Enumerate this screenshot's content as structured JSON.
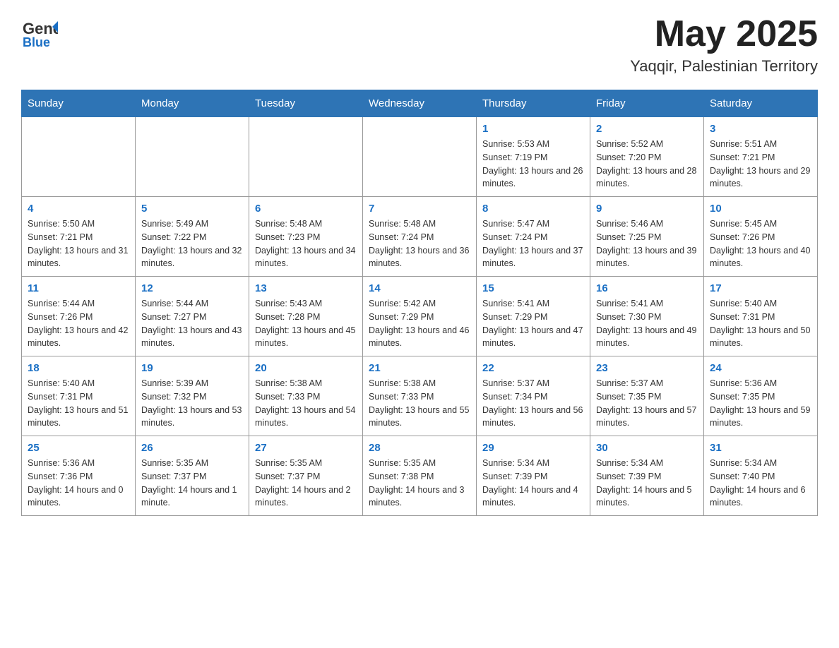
{
  "header": {
    "logo_general": "General",
    "logo_blue": "Blue",
    "month_title": "May 2025",
    "location": "Yaqqir, Palestinian Territory"
  },
  "days_of_week": [
    "Sunday",
    "Monday",
    "Tuesday",
    "Wednesday",
    "Thursday",
    "Friday",
    "Saturday"
  ],
  "weeks": [
    {
      "days": [
        {
          "num": "",
          "info": ""
        },
        {
          "num": "",
          "info": ""
        },
        {
          "num": "",
          "info": ""
        },
        {
          "num": "",
          "info": ""
        },
        {
          "num": "1",
          "info": "Sunrise: 5:53 AM\nSunset: 7:19 PM\nDaylight: 13 hours and 26 minutes."
        },
        {
          "num": "2",
          "info": "Sunrise: 5:52 AM\nSunset: 7:20 PM\nDaylight: 13 hours and 28 minutes."
        },
        {
          "num": "3",
          "info": "Sunrise: 5:51 AM\nSunset: 7:21 PM\nDaylight: 13 hours and 29 minutes."
        }
      ]
    },
    {
      "days": [
        {
          "num": "4",
          "info": "Sunrise: 5:50 AM\nSunset: 7:21 PM\nDaylight: 13 hours and 31 minutes."
        },
        {
          "num": "5",
          "info": "Sunrise: 5:49 AM\nSunset: 7:22 PM\nDaylight: 13 hours and 32 minutes."
        },
        {
          "num": "6",
          "info": "Sunrise: 5:48 AM\nSunset: 7:23 PM\nDaylight: 13 hours and 34 minutes."
        },
        {
          "num": "7",
          "info": "Sunrise: 5:48 AM\nSunset: 7:24 PM\nDaylight: 13 hours and 36 minutes."
        },
        {
          "num": "8",
          "info": "Sunrise: 5:47 AM\nSunset: 7:24 PM\nDaylight: 13 hours and 37 minutes."
        },
        {
          "num": "9",
          "info": "Sunrise: 5:46 AM\nSunset: 7:25 PM\nDaylight: 13 hours and 39 minutes."
        },
        {
          "num": "10",
          "info": "Sunrise: 5:45 AM\nSunset: 7:26 PM\nDaylight: 13 hours and 40 minutes."
        }
      ]
    },
    {
      "days": [
        {
          "num": "11",
          "info": "Sunrise: 5:44 AM\nSunset: 7:26 PM\nDaylight: 13 hours and 42 minutes."
        },
        {
          "num": "12",
          "info": "Sunrise: 5:44 AM\nSunset: 7:27 PM\nDaylight: 13 hours and 43 minutes."
        },
        {
          "num": "13",
          "info": "Sunrise: 5:43 AM\nSunset: 7:28 PM\nDaylight: 13 hours and 45 minutes."
        },
        {
          "num": "14",
          "info": "Sunrise: 5:42 AM\nSunset: 7:29 PM\nDaylight: 13 hours and 46 minutes."
        },
        {
          "num": "15",
          "info": "Sunrise: 5:41 AM\nSunset: 7:29 PM\nDaylight: 13 hours and 47 minutes."
        },
        {
          "num": "16",
          "info": "Sunrise: 5:41 AM\nSunset: 7:30 PM\nDaylight: 13 hours and 49 minutes."
        },
        {
          "num": "17",
          "info": "Sunrise: 5:40 AM\nSunset: 7:31 PM\nDaylight: 13 hours and 50 minutes."
        }
      ]
    },
    {
      "days": [
        {
          "num": "18",
          "info": "Sunrise: 5:40 AM\nSunset: 7:31 PM\nDaylight: 13 hours and 51 minutes."
        },
        {
          "num": "19",
          "info": "Sunrise: 5:39 AM\nSunset: 7:32 PM\nDaylight: 13 hours and 53 minutes."
        },
        {
          "num": "20",
          "info": "Sunrise: 5:38 AM\nSunset: 7:33 PM\nDaylight: 13 hours and 54 minutes."
        },
        {
          "num": "21",
          "info": "Sunrise: 5:38 AM\nSunset: 7:33 PM\nDaylight: 13 hours and 55 minutes."
        },
        {
          "num": "22",
          "info": "Sunrise: 5:37 AM\nSunset: 7:34 PM\nDaylight: 13 hours and 56 minutes."
        },
        {
          "num": "23",
          "info": "Sunrise: 5:37 AM\nSunset: 7:35 PM\nDaylight: 13 hours and 57 minutes."
        },
        {
          "num": "24",
          "info": "Sunrise: 5:36 AM\nSunset: 7:35 PM\nDaylight: 13 hours and 59 minutes."
        }
      ]
    },
    {
      "days": [
        {
          "num": "25",
          "info": "Sunrise: 5:36 AM\nSunset: 7:36 PM\nDaylight: 14 hours and 0 minutes."
        },
        {
          "num": "26",
          "info": "Sunrise: 5:35 AM\nSunset: 7:37 PM\nDaylight: 14 hours and 1 minute."
        },
        {
          "num": "27",
          "info": "Sunrise: 5:35 AM\nSunset: 7:37 PM\nDaylight: 14 hours and 2 minutes."
        },
        {
          "num": "28",
          "info": "Sunrise: 5:35 AM\nSunset: 7:38 PM\nDaylight: 14 hours and 3 minutes."
        },
        {
          "num": "29",
          "info": "Sunrise: 5:34 AM\nSunset: 7:39 PM\nDaylight: 14 hours and 4 minutes."
        },
        {
          "num": "30",
          "info": "Sunrise: 5:34 AM\nSunset: 7:39 PM\nDaylight: 14 hours and 5 minutes."
        },
        {
          "num": "31",
          "info": "Sunrise: 5:34 AM\nSunset: 7:40 PM\nDaylight: 14 hours and 6 minutes."
        }
      ]
    }
  ]
}
